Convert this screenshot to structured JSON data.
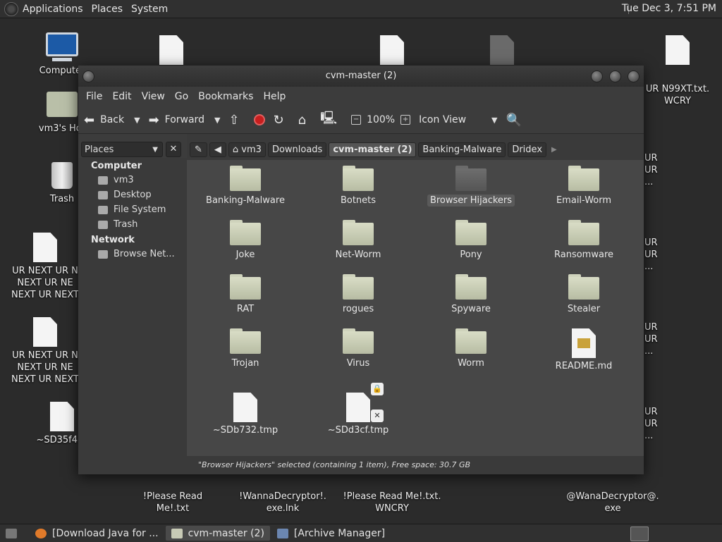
{
  "top_panel": {
    "menus": [
      "Applications",
      "Places",
      "System"
    ],
    "clock": "Tue Dec  3,  7:51 PM"
  },
  "desktop": {
    "computer": "Computer",
    "home": "vm3's Hor",
    "trash": "Trash",
    "note1_line1": "UR NEXT UR N",
    "note1_line2": "NEXT UR NE",
    "note1_line3": "NEXT UR NEXT",
    "note2_line1": "UR NEXT UR N",
    "note2_line2": "NEXT UR NE",
    "note2_line3": "NEXT UR NEXT",
    "sd35": "~SD35f4.tr",
    "right_top_line1": "UR N99XT.txt.",
    "right_top_line2": "WCRY",
    "right_ur": "UR",
    "right_ur_cont": "...",
    "please1": "!Please Read Me!.txt",
    "wannaexe_line1": "!WannaDecryptor!.",
    "wannaexe_line2": "exe.lnk",
    "please2_line1": "!Please Read Me!.txt.",
    "please2_line2": "WNCRY",
    "wana_line1": "@WanaDecryptor@.",
    "wana_line2": "exe"
  },
  "window": {
    "title": "cvm-master (2)",
    "menus": [
      "File",
      "Edit",
      "View",
      "Go",
      "Bookmarks",
      "Help"
    ],
    "toolbar": {
      "back": "Back",
      "forward": "Forward",
      "zoom": "100%",
      "view_mode": "Icon View"
    },
    "sidebar": {
      "combo": "Places",
      "sections": [
        {
          "title": "Computer",
          "items": [
            "vm3",
            "Desktop",
            "File System",
            "Trash"
          ]
        },
        {
          "title": "Network",
          "items": [
            "Browse Net..."
          ]
        }
      ]
    },
    "breadcrumbs": [
      "vm3",
      "Downloads",
      "cvm-master (2)",
      "Banking-Malware",
      "Dridex"
    ],
    "files": [
      {
        "name": "Banking-Malware",
        "type": "folder"
      },
      {
        "name": "Botnets",
        "type": "folder"
      },
      {
        "name": "Browser Hijackers",
        "type": "folder",
        "selected": true
      },
      {
        "name": "Email-Worm",
        "type": "folder"
      },
      {
        "name": "Joke",
        "type": "folder"
      },
      {
        "name": "Net-Worm",
        "type": "folder"
      },
      {
        "name": "Pony",
        "type": "folder"
      },
      {
        "name": "Ransomware",
        "type": "folder"
      },
      {
        "name": "RAT",
        "type": "folder"
      },
      {
        "name": "rogues",
        "type": "folder"
      },
      {
        "name": "Spyware",
        "type": "folder"
      },
      {
        "name": "Stealer",
        "type": "folder"
      },
      {
        "name": "Trojan",
        "type": "folder"
      },
      {
        "name": "Virus",
        "type": "folder"
      },
      {
        "name": "Worm",
        "type": "folder"
      },
      {
        "name": "README.md",
        "type": "document"
      },
      {
        "name": "~SDb732.tmp",
        "type": "file"
      },
      {
        "name": "~SDd3cf.tmp",
        "type": "file-locked"
      }
    ],
    "status": "\"Browser Hijackers\" selected (containing 1 item), Free space: 30.7 GB"
  },
  "taskbar": {
    "tasks": [
      "[Download Java for ...",
      "cvm-master (2)",
      "[Archive Manager]"
    ]
  }
}
